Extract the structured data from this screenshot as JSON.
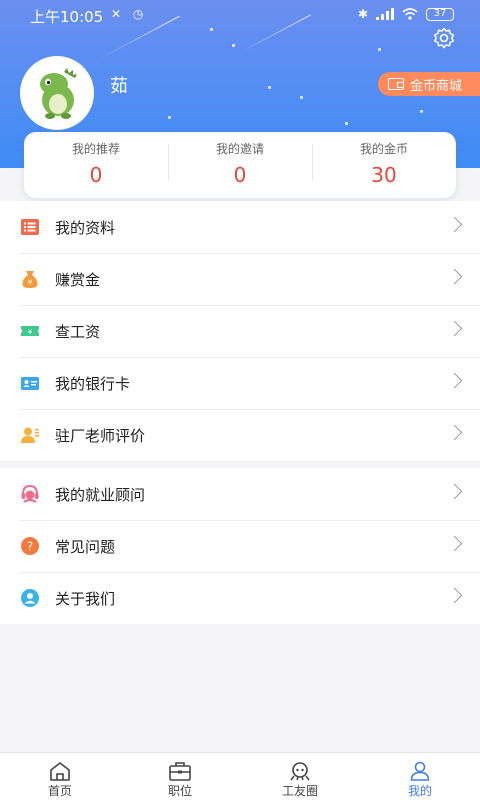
{
  "status_bar": {
    "time": "上午10:05",
    "indicators": "✕ ◷",
    "battery": "37"
  },
  "profile": {
    "username": "茹",
    "coin_mall_label": "金币商城"
  },
  "stats": [
    {
      "label": "我的推荐",
      "value": "0"
    },
    {
      "label": "我的邀请",
      "value": "0"
    },
    {
      "label": "我的金币",
      "value": "30"
    }
  ],
  "menu_group_1": [
    {
      "label": "我的资料",
      "icon": "list-icon",
      "color": "#f26b4d"
    },
    {
      "label": "赚赏金",
      "icon": "money-bag-icon",
      "color": "#f59a3c"
    },
    {
      "label": "查工资",
      "icon": "ticket-icon",
      "color": "#3ec98e"
    },
    {
      "label": "我的银行卡",
      "icon": "id-card-icon",
      "color": "#3aa7f0"
    },
    {
      "label": "驻厂老师评价",
      "icon": "teacher-icon",
      "color": "#f5b23c"
    }
  ],
  "menu_group_2": [
    {
      "label": "我的就业顾问",
      "icon": "advisor-icon",
      "color": "#f26b8a"
    },
    {
      "label": "常见问题",
      "icon": "question-icon",
      "color": "#f5793c"
    },
    {
      "label": "关于我们",
      "icon": "about-icon",
      "color": "#3ab3e8"
    }
  ],
  "tabbar": [
    {
      "label": "首页",
      "icon": "home-icon"
    },
    {
      "label": "职位",
      "icon": "briefcase-icon"
    },
    {
      "label": "工友圈",
      "icon": "community-icon"
    },
    {
      "label": "我的",
      "icon": "profile-icon",
      "active": true
    }
  ],
  "colors": {
    "header_top": "#6b8ff0",
    "header_bottom": "#3f8cf6",
    "stat_value": "#e8453c",
    "coin_mall_bg": "#ff8a5b",
    "tab_active": "#3d7cf0"
  }
}
